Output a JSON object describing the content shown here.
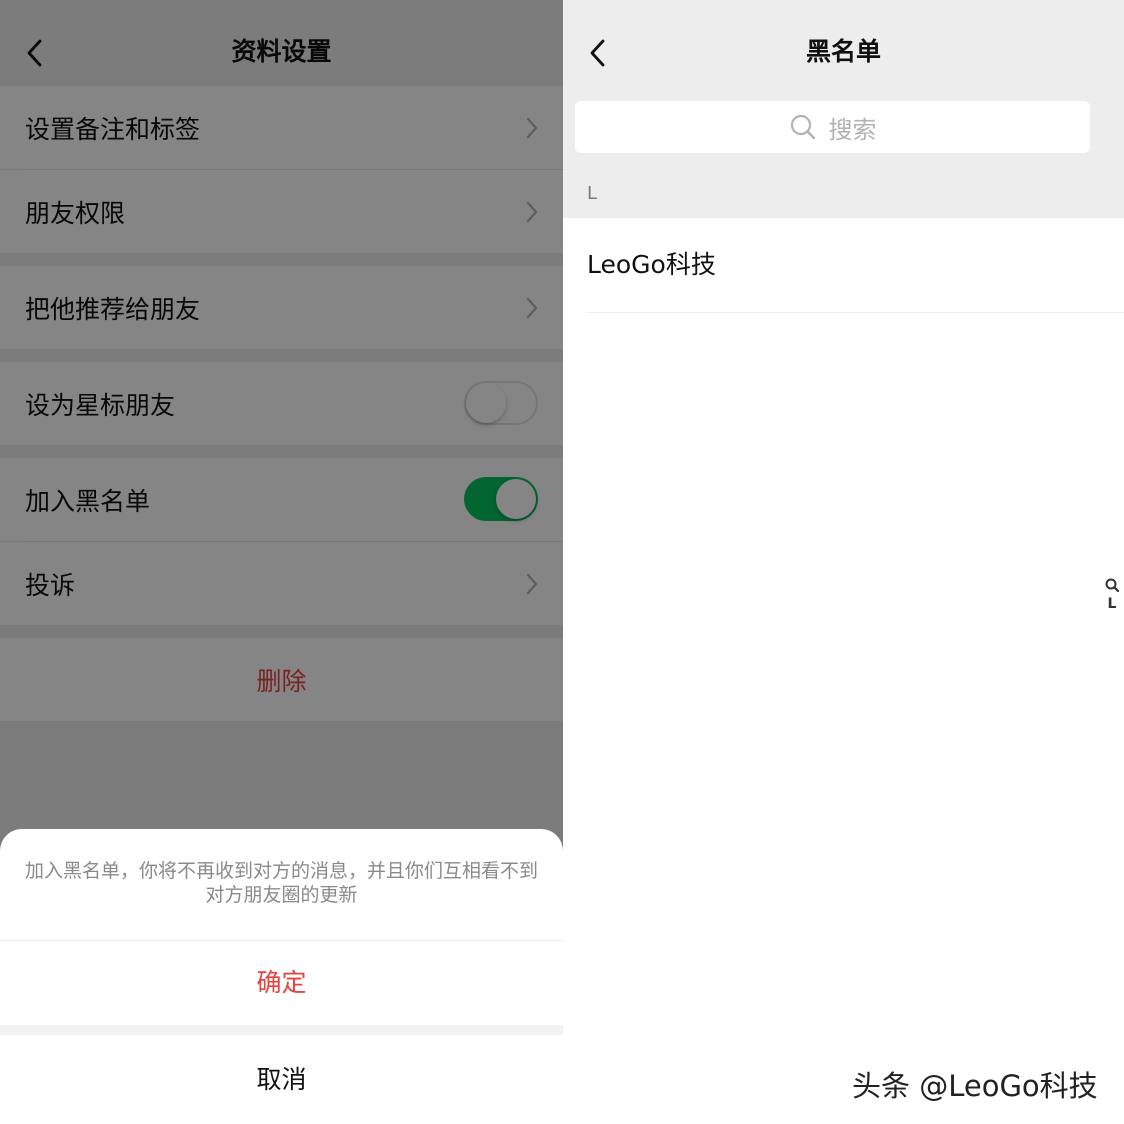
{
  "left_screen": {
    "title": "资料设置",
    "items": [
      {
        "label": "设置备注和标签"
      },
      {
        "label": "朋友权限"
      },
      {
        "label": "把他推荐给朋友"
      },
      {
        "label": "设为星标朋友",
        "toggle": "off"
      },
      {
        "label": "加入黑名单",
        "toggle": "on"
      },
      {
        "label": "投诉"
      }
    ],
    "delete_label": "删除",
    "action_sheet": {
      "message": "加入黑名单，你将不再收到对方的消息，并且你们互相看不到对方朋友圈的更新",
      "confirm_label": "确定",
      "cancel_label": "取消"
    },
    "colors": {
      "accent_green": "#07c160",
      "danger_red": "#e64340"
    }
  },
  "right_screen": {
    "title": "黑名单",
    "search_placeholder": "搜索",
    "section_header": "L",
    "entries": [
      "LeoGo科技"
    ],
    "index_letters": [
      "L"
    ]
  },
  "watermark": "头条 @LeoGo科技"
}
